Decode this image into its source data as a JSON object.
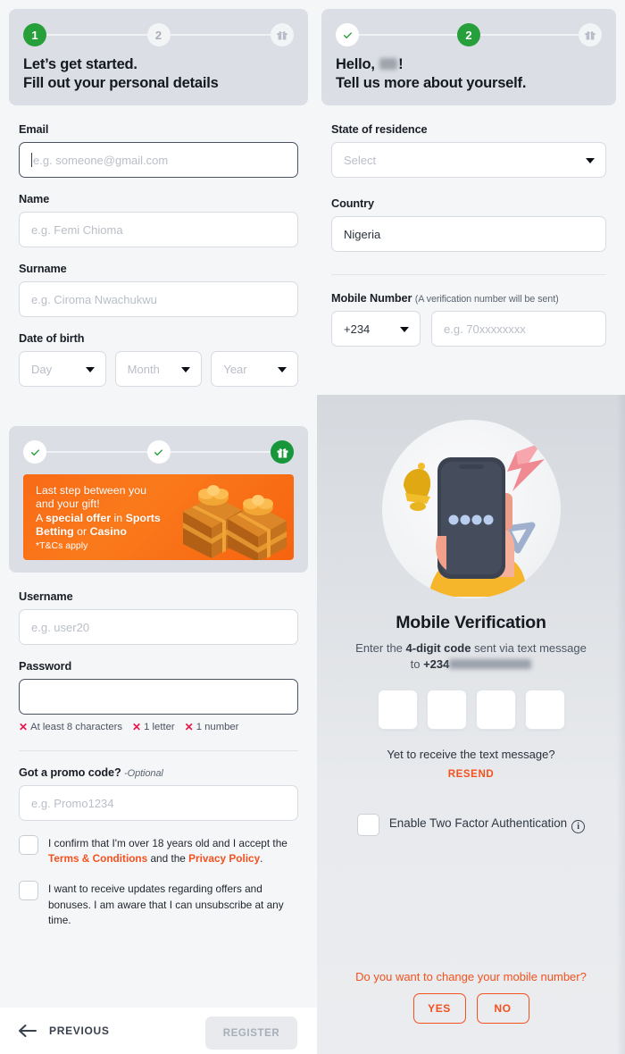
{
  "step1": {
    "nodes": [
      "1",
      "2",
      "gift-icon"
    ],
    "title_line1": "Let’s get started.",
    "title_line2": "Fill out your personal details",
    "fields": {
      "email_label": "Email",
      "email_placeholder": "e.g. someone@gmail.com",
      "name_label": "Name",
      "name_placeholder": "e.g. Femi Chioma",
      "surname_label": "Surname",
      "surname_placeholder": "e.g. Ciroma Nwachukwu",
      "dob_label": "Date of birth",
      "dob_day": "Day",
      "dob_month": "Month",
      "dob_year": "Year"
    }
  },
  "step2": {
    "title_line1_prefix": "Hello, ",
    "title_line1_suffix": "!",
    "title_line2": "Tell us more about yourself.",
    "fields": {
      "state_label": "State of residence",
      "state_value": "Select",
      "country_label": "Country",
      "country_value": "Nigeria",
      "mobile_label": "Mobile Number",
      "mobile_hint": "(A verification number will be sent)",
      "dial_code": "+234",
      "mobile_placeholder": "e.g. 70xxxxxxxx"
    }
  },
  "step3": {
    "promo": {
      "line1": "Last step between you",
      "line2": "and your gift!",
      "line3_a": "A ",
      "line3_b": "special offer",
      "line3_c": " in ",
      "line3_d": "Sports",
      "line4_a": "Betting",
      "line4_b": " or ",
      "line4_c": "Casino",
      "terms": "*T&Cs apply"
    },
    "fields": {
      "username_label": "Username",
      "username_placeholder": "e.g. user20",
      "password_label": "Password",
      "password_value": "",
      "promo_label": "Got a promo code?",
      "promo_optional": "-Optional",
      "promo_placeholder": "e.g. Promo1234"
    },
    "password_rules": [
      "At least 8 characters",
      "1 letter",
      "1 number"
    ],
    "consent1": {
      "part1": "I confirm that I'm over 18 years old and I accept the ",
      "link1": "Terms & Conditions",
      "part2": " and the ",
      "link2": "Privacy Policy",
      "part3": "."
    },
    "consent2": "I want to receive updates regarding offers and bonuses. I am aware that I can unsubscribe at any time."
  },
  "footer": {
    "previous_label": "PREVIOUS",
    "register_label": "REGISTER"
  },
  "verification": {
    "title": "Mobile Verification",
    "sub_a": "Enter the ",
    "sub_b": "4-digit code",
    "sub_c": " sent via text message",
    "sub_d": "to ",
    "sub_dial": "+234",
    "code_digits": [
      "",
      "",
      "",
      ""
    ],
    "yet_text": "Yet to receive the text message?",
    "resend_label": "RESEND",
    "twofa_label": "Enable Two Factor Authentication",
    "info_glyph": "i",
    "change_question": "Do you want to change your mobile number?",
    "yes_label": "YES",
    "no_label": "NO"
  },
  "colors": {
    "green": "#27a03c",
    "orange": "#f4511e",
    "promo_orange": "#f96a16",
    "error_red": "#e8174a",
    "card_gray": "#dcdee5",
    "page_gray": "#f5f6f8"
  }
}
